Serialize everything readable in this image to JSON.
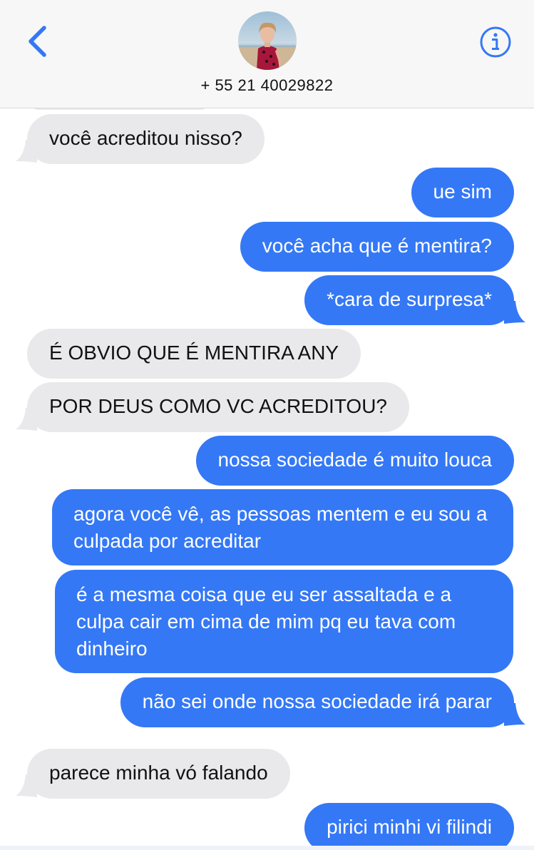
{
  "header": {
    "contact_number": "+ 55 21 40029822",
    "back_icon": "chevron-left-icon",
    "info_icon": "info-circle-icon",
    "accent_color": "#3478f6"
  },
  "colors": {
    "incoming_bubble": "#e9e9eb",
    "outgoing_bubble": "#3478f6",
    "outgoing_text": "#ffffff",
    "incoming_text": "#111111"
  },
  "messages": [
    {
      "direction": "in",
      "text": "você acreditou nisso?"
    },
    {
      "direction": "out",
      "text": "ue sim"
    },
    {
      "direction": "out",
      "text": "você acha que é mentira?"
    },
    {
      "direction": "out",
      "text": "*cara de surpresa*"
    },
    {
      "direction": "in",
      "text": "É OBVIO QUE É MENTIRA ANY"
    },
    {
      "direction": "in",
      "text": "POR DEUS COMO VC ACREDITOU?"
    },
    {
      "direction": "out",
      "text": "nossa sociedade é muito louca"
    },
    {
      "direction": "out",
      "text": "agora você vê, as pessoas mentem e eu sou a culpada por acreditar"
    },
    {
      "direction": "out",
      "text": "é a mesma coisa que eu ser assaltada e a culpa cair em cima de mim pq eu tava com dinheiro"
    },
    {
      "direction": "out",
      "text": "não sei onde nossa sociedade irá parar"
    },
    {
      "direction": "in",
      "text": "parece minha vó falando"
    },
    {
      "direction": "out",
      "text": "pirici minhi vi filindi"
    }
  ]
}
